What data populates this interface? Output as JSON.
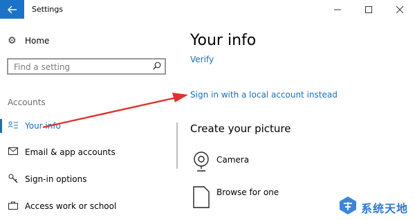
{
  "window": {
    "title": "Settings"
  },
  "sidebar": {
    "home_label": "Home",
    "search_placeholder": "Find a setting",
    "section_label": "Accounts",
    "items": [
      {
        "label": "Your info",
        "icon": "person-card-icon",
        "active": true
      },
      {
        "label": "Email & app accounts",
        "icon": "mail-icon"
      },
      {
        "label": "Sign-in options",
        "icon": "key-icon"
      },
      {
        "label": "Access work or school",
        "icon": "briefcase-icon"
      }
    ]
  },
  "main": {
    "title": "Your info",
    "verify_link": "Verify",
    "local_account_link": "Sign in with a local account instead",
    "picture_title": "Create your picture",
    "picture_options": [
      {
        "label": "Camera",
        "icon": "camera-icon"
      },
      {
        "label": "Browse for one",
        "icon": "browse-file-icon"
      }
    ]
  },
  "watermark": {
    "text": "系统天地"
  },
  "colors": {
    "accent": "#1a6fb5",
    "back_button": "#1a73c6",
    "annotation_arrow": "#e0322c"
  }
}
